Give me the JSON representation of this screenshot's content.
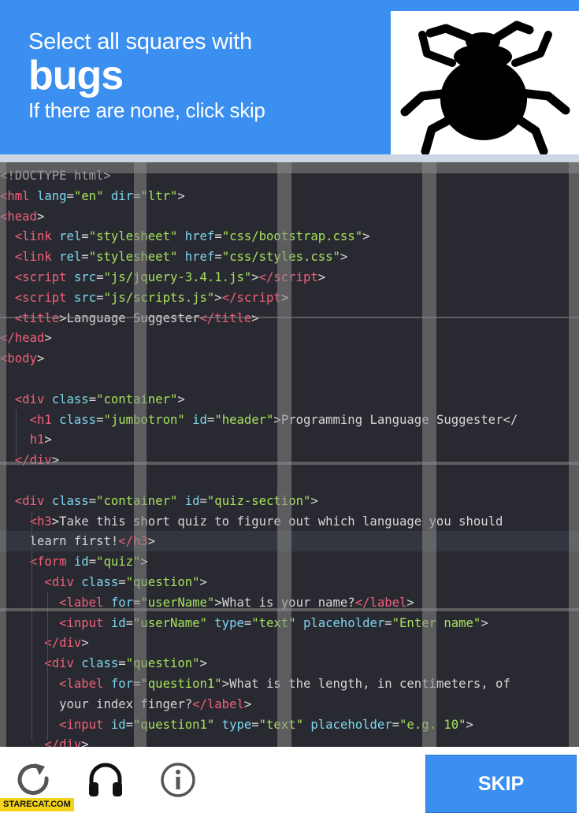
{
  "header": {
    "instruction_line1": "Select all squares with",
    "target_word": "bugs",
    "instruction_line3": "If there are none, click skip",
    "example_image_icon": "bug-silhouette-icon"
  },
  "colors": {
    "header_blue": "#3a8ff0",
    "code_bg": "#26272c",
    "tag": "#f0607a",
    "attr": "#7dd6f0",
    "string": "#a6e05e",
    "text": "#d6d6d6",
    "comment": "#a0a0a0"
  },
  "code_lines": [
    [
      [
        "<!DOCTYPE html>",
        "comment"
      ]
    ],
    [
      [
        "<",
        "tag"
      ],
      [
        "hml",
        "tag"
      ],
      [
        " lang",
        "attr"
      ],
      [
        "=",
        "text"
      ],
      [
        "\"en\"",
        "string"
      ],
      [
        " dir",
        "attr"
      ],
      [
        "=",
        "text"
      ],
      [
        "\"ltr\"",
        "string"
      ],
      [
        ">",
        "text"
      ]
    ],
    [
      [
        "<",
        "tag"
      ],
      [
        "head",
        "tag"
      ],
      [
        ">",
        "text"
      ]
    ],
    [
      [
        "  ",
        "text"
      ],
      [
        "<",
        "tag"
      ],
      [
        "link",
        "tag"
      ],
      [
        " rel",
        "attr"
      ],
      [
        "=",
        "text"
      ],
      [
        "\"stylesheet\"",
        "string"
      ],
      [
        " href",
        "attr"
      ],
      [
        "=",
        "text"
      ],
      [
        "\"css/bootstrap.css\"",
        "string"
      ],
      [
        ">",
        "text"
      ]
    ],
    [
      [
        "  ",
        "text"
      ],
      [
        "<",
        "tag"
      ],
      [
        "link",
        "tag"
      ],
      [
        " rel",
        "attr"
      ],
      [
        "=",
        "text"
      ],
      [
        "\"stylesheet\"",
        "string"
      ],
      [
        " href",
        "attr"
      ],
      [
        "=",
        "text"
      ],
      [
        "\"css/styles.css\"",
        "string"
      ],
      [
        ">",
        "text"
      ]
    ],
    [
      [
        "  ",
        "text"
      ],
      [
        "<",
        "tag"
      ],
      [
        "script",
        "tag"
      ],
      [
        " src",
        "attr"
      ],
      [
        "=",
        "text"
      ],
      [
        "\"js/jquery-3.4.1.js\"",
        "string"
      ],
      [
        ">",
        "text"
      ],
      [
        "</",
        "tag"
      ],
      [
        "script",
        "tag"
      ],
      [
        ">",
        "text"
      ]
    ],
    [
      [
        "  ",
        "text"
      ],
      [
        "<",
        "tag"
      ],
      [
        "script",
        "tag"
      ],
      [
        " src",
        "attr"
      ],
      [
        "=",
        "text"
      ],
      [
        "\"js/scripts.js\"",
        "string"
      ],
      [
        ">",
        "text"
      ],
      [
        "</",
        "tag"
      ],
      [
        "script",
        "tag"
      ],
      [
        ">",
        "text"
      ]
    ],
    [
      [
        "  ",
        "text"
      ],
      [
        "<",
        "tag"
      ],
      [
        "title",
        "tag"
      ],
      [
        ">",
        "text"
      ],
      [
        "Language Suggester",
        "text"
      ],
      [
        "</",
        "tag"
      ],
      [
        "title",
        "tag"
      ],
      [
        ">",
        "text"
      ]
    ],
    [
      [
        "</",
        "tag"
      ],
      [
        "head",
        "tag"
      ],
      [
        ">",
        "text"
      ]
    ],
    [
      [
        "<",
        "tag"
      ],
      [
        "body",
        "tag"
      ],
      [
        ">",
        "text"
      ]
    ],
    [
      [
        "",
        "text"
      ]
    ],
    [
      [
        "  ",
        "text"
      ],
      [
        "<",
        "tag"
      ],
      [
        "div",
        "tag"
      ],
      [
        " class",
        "attr"
      ],
      [
        "=",
        "text"
      ],
      [
        "\"container\"",
        "string"
      ],
      [
        ">",
        "text"
      ]
    ],
    [
      [
        "    ",
        "text"
      ],
      [
        "<",
        "tag"
      ],
      [
        "h1",
        "tag"
      ],
      [
        " class",
        "attr"
      ],
      [
        "=",
        "text"
      ],
      [
        "\"jumbotron\"",
        "string"
      ],
      [
        " id",
        "attr"
      ],
      [
        "=",
        "text"
      ],
      [
        "\"header\"",
        "string"
      ],
      [
        ">",
        "text"
      ],
      [
        "Programming Language Suggester</",
        "text"
      ]
    ],
    [
      [
        "    ",
        "text"
      ],
      [
        "h1",
        "tag"
      ],
      [
        ">",
        "text"
      ]
    ],
    [
      [
        "  ",
        "text"
      ],
      [
        "</",
        "tag"
      ],
      [
        "div",
        "tag"
      ],
      [
        ">",
        "text"
      ]
    ],
    [
      [
        "",
        "text"
      ]
    ],
    [
      [
        "  ",
        "text"
      ],
      [
        "<",
        "tag"
      ],
      [
        "div",
        "tag"
      ],
      [
        " class",
        "attr"
      ],
      [
        "=",
        "text"
      ],
      [
        "\"container\"",
        "string"
      ],
      [
        " id",
        "attr"
      ],
      [
        "=",
        "text"
      ],
      [
        "\"quiz-section\"",
        "string"
      ],
      [
        ">",
        "text"
      ]
    ],
    [
      [
        "    ",
        "text"
      ],
      [
        "<",
        "tag"
      ],
      [
        "h3",
        "tag"
      ],
      [
        ">",
        "text"
      ],
      [
        "Take this short quiz to figure out which language you should",
        "text"
      ]
    ],
    [
      [
        "    ",
        "text"
      ],
      [
        "learn first!",
        "text"
      ],
      [
        "</",
        "tag"
      ],
      [
        "h3",
        "tag"
      ],
      [
        ">",
        "text"
      ]
    ],
    [
      [
        "    ",
        "text"
      ],
      [
        "<",
        "tag"
      ],
      [
        "form",
        "tag"
      ],
      [
        " id",
        "attr"
      ],
      [
        "=",
        "text"
      ],
      [
        "\"quiz\"",
        "string"
      ],
      [
        ">",
        "text"
      ]
    ],
    [
      [
        "      ",
        "text"
      ],
      [
        "<",
        "tag"
      ],
      [
        "div",
        "tag"
      ],
      [
        " class",
        "attr"
      ],
      [
        "=",
        "text"
      ],
      [
        "\"question\"",
        "string"
      ],
      [
        ">",
        "text"
      ]
    ],
    [
      [
        "        ",
        "text"
      ],
      [
        "<",
        "tag"
      ],
      [
        "label",
        "tag"
      ],
      [
        " for",
        "attr"
      ],
      [
        "=",
        "text"
      ],
      [
        "\"userName\"",
        "string"
      ],
      [
        ">",
        "text"
      ],
      [
        "What is your name?",
        "text"
      ],
      [
        "</",
        "tag"
      ],
      [
        "label",
        "tag"
      ],
      [
        ">",
        "text"
      ]
    ],
    [
      [
        "        ",
        "text"
      ],
      [
        "<",
        "tag"
      ],
      [
        "input",
        "tag"
      ],
      [
        " id",
        "attr"
      ],
      [
        "=",
        "text"
      ],
      [
        "\"userName\"",
        "string"
      ],
      [
        " type",
        "attr"
      ],
      [
        "=",
        "text"
      ],
      [
        "\"text\"",
        "string"
      ],
      [
        " placeholder",
        "attr"
      ],
      [
        "=",
        "text"
      ],
      [
        "\"Enter name\"",
        "string"
      ],
      [
        ">",
        "text"
      ]
    ],
    [
      [
        "      ",
        "text"
      ],
      [
        "</",
        "tag"
      ],
      [
        "div",
        "tag"
      ],
      [
        ">",
        "text"
      ]
    ],
    [
      [
        "      ",
        "text"
      ],
      [
        "<",
        "tag"
      ],
      [
        "div",
        "tag"
      ],
      [
        " class",
        "attr"
      ],
      [
        "=",
        "text"
      ],
      [
        "\"question\"",
        "string"
      ],
      [
        ">",
        "text"
      ]
    ],
    [
      [
        "        ",
        "text"
      ],
      [
        "<",
        "tag"
      ],
      [
        "label",
        "tag"
      ],
      [
        " for",
        "attr"
      ],
      [
        "=",
        "text"
      ],
      [
        "\"question1\"",
        "string"
      ],
      [
        ">",
        "text"
      ],
      [
        "What is the length, in centimeters, of",
        "text"
      ]
    ],
    [
      [
        "        ",
        "text"
      ],
      [
        "your index finger?",
        "text"
      ],
      [
        "</",
        "tag"
      ],
      [
        "label",
        "tag"
      ],
      [
        ">",
        "text"
      ]
    ],
    [
      [
        "        ",
        "text"
      ],
      [
        "<",
        "tag"
      ],
      [
        "input",
        "tag"
      ],
      [
        " id",
        "attr"
      ],
      [
        "=",
        "text"
      ],
      [
        "\"question1\"",
        "string"
      ],
      [
        " type",
        "attr"
      ],
      [
        "=",
        "text"
      ],
      [
        "\"text\"",
        "string"
      ],
      [
        " placeholder",
        "attr"
      ],
      [
        "=",
        "text"
      ],
      [
        "\"e.g. 10\"",
        "string"
      ],
      [
        ">",
        "text"
      ]
    ],
    [
      [
        "      ",
        "text"
      ],
      [
        "</",
        "tag"
      ],
      [
        "div",
        "tag"
      ],
      [
        ">",
        "text"
      ]
    ]
  ],
  "controls": {
    "reload_icon": "reload-icon",
    "audio_icon": "headphones-icon",
    "info_icon": "info-icon",
    "skip_label": "SKIP"
  },
  "watermark": "STARECAT.COM"
}
